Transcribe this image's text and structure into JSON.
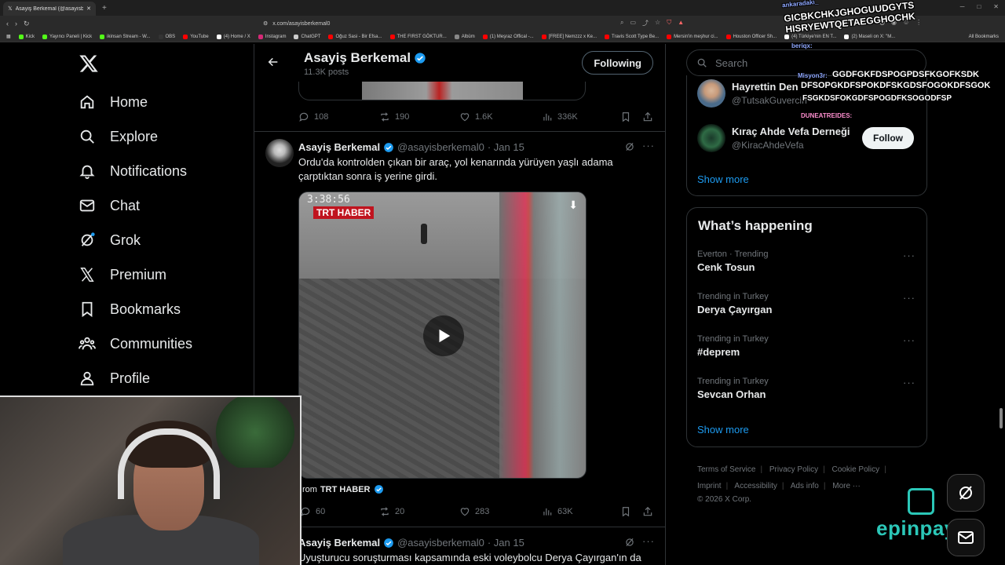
{
  "browser": {
    "tab_title": "Asayiş Berkemal (@asayisbe",
    "url": "x.com/asayisberkemal0",
    "bookmarks": [
      "Kick",
      "Yayıncı Paneli | Kick",
      "ikinsan Stream - W...",
      "OBS",
      "YouTube",
      "(4) Home / X",
      "Instagram",
      "ChatGPT",
      "Oğuz Sasi - Bir Efsa...",
      "THE FIRST GÖKTUR...",
      "Albüm",
      "(1) Meşraz Offical -...",
      "[FREE] Nemzzz x Ke...",
      "Travis Scott Type Be...",
      "Mersin'in meşhur ci...",
      "Houston Officer Sh...",
      "(4) Türkiye'nin EN T...",
      "(2) Maseli on X: \"M..."
    ],
    "all_bookmarks": "All Bookmarks"
  },
  "nav": {
    "items": [
      {
        "label": "Home",
        "icon": "home-icon"
      },
      {
        "label": "Explore",
        "icon": "search-icon"
      },
      {
        "label": "Notifications",
        "icon": "bell-icon"
      },
      {
        "label": "Chat",
        "icon": "mail-icon"
      },
      {
        "label": "Grok",
        "icon": "grok-icon"
      },
      {
        "label": "Premium",
        "icon": "x-logo-icon"
      },
      {
        "label": "Bookmarks",
        "icon": "bookmark-icon"
      },
      {
        "label": "Communities",
        "icon": "people-icon"
      },
      {
        "label": "Profile",
        "icon": "person-icon"
      }
    ]
  },
  "profile_header": {
    "name": "Asayiş Berkemal",
    "posts": "11.3K posts",
    "following_label": "Following"
  },
  "tweet0_actions": {
    "replies": "108",
    "reposts": "190",
    "likes": "1.6K",
    "views": "336K"
  },
  "tweet1": {
    "name": "Asayiş Berkemal",
    "handle": "@asayisberkemal0",
    "date": "· Jan 15",
    "text_line1": "Ordu'da kontrolden çıkan bir araç, yol kenarında yürüyen yaşlı adama",
    "text_line2": "çarptıktan sonra iş yerine girdi.",
    "video_timestamp": "3:38:56",
    "video_badge": "TRT HABER",
    "from_prefix": "rom",
    "from_source": "TRT HABER",
    "replies": "60",
    "reposts": "20",
    "likes": "283",
    "views": "63K"
  },
  "tweet2": {
    "name": "Asayiş Berkemal",
    "handle": "@asayisberkemal0",
    "date": "· Jan 15",
    "text": "Uyuşturucu soruşturması kapsamında eski voleybolcu Derya Çayırgan'ın da"
  },
  "search": {
    "placeholder": "Search"
  },
  "who_to_follow": [
    {
      "name": "Hayrettin Den",
      "handle": "@TutsakGuvercin"
    },
    {
      "name": "Kıraç Ahde Vefa Derneği",
      "handle": "@KiracAhdeVefa",
      "button": "Follow"
    }
  ],
  "show_more": "Show more",
  "trending": {
    "title": "What’s happening",
    "items": [
      {
        "context": "Everton · Trending",
        "topic": "Cenk Tosun"
      },
      {
        "context": "Trending in Turkey",
        "topic": "Derya Çayırgan"
      },
      {
        "context": "Trending in Turkey",
        "topic": "#deprem"
      },
      {
        "context": "Trending in Turkey",
        "topic": "Sevcan Orhan"
      }
    ],
    "show_more": "Show more"
  },
  "footer": {
    "links": [
      "Terms of Service",
      "Privacy Policy",
      "Cookie Policy",
      "Imprint",
      "Accessibility",
      "Ads info",
      "More ···"
    ],
    "copyright": "© 2026 X Corp."
  },
  "chat_overlay": {
    "l1_user": "ankaradaki_",
    "l1": "GICBKCHKJGHOGUUDGYTS",
    "l2": "HISRYEWTQETAEGGHOCHK",
    "l3_user": "beriqx:",
    "l4_user": "Misyon3r:",
    "l4": "GGDFGKFDSPOGPDSFKGOFKSDK",
    "l5": "DFSOPGKDFSPOKDFSKGDSFOGOKDFSGOK",
    "l6": "FSGKDSFOKGDFSPOGDFKSOGODFSP",
    "l7_user": "DUNEATREIDES:"
  },
  "sponsor": "epinpay",
  "colors": {
    "accent": "#1d9bf0",
    "verified": "#1d9bf0",
    "border": "#2f3336",
    "muted": "#71767b"
  }
}
